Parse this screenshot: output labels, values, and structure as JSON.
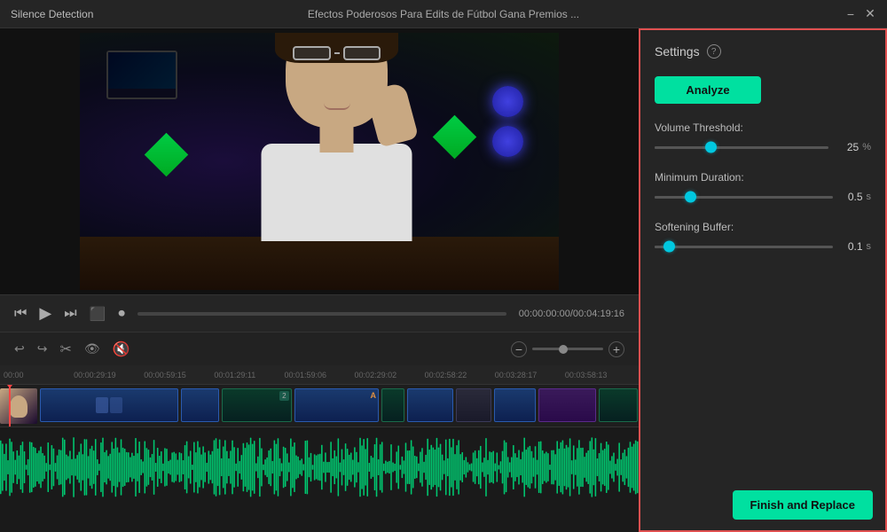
{
  "titleBar": {
    "appName": "Silence Detection",
    "videoTitle": "Efectos Poderosos Para Edits de Fútbol  Gana Premios ...",
    "minimizeLabel": "−",
    "closeLabel": "✕"
  },
  "player": {
    "currentTime": "00:00:00:00",
    "totalTime": "00:04:19:16",
    "timeDisplay": "00:00:00:00/00:04:19:16"
  },
  "settings": {
    "title": "Settings",
    "helpTooltip": "?",
    "analyzeLabel": "Analyze",
    "volumeThreshold": {
      "label": "Volume Threshold:",
      "value": "25",
      "unit": "%",
      "fillPercent": 32
    },
    "minimumDuration": {
      "label": "Minimum Duration:",
      "value": "0.5",
      "unit": "s",
      "fillPercent": 20
    },
    "softeningBuffer": {
      "label": "Softening Buffer:",
      "value": "0.1",
      "unit": "s",
      "fillPercent": 8
    }
  },
  "timeline": {
    "timeMarkers": [
      "00:00",
      "00:00:29:19",
      "00:00:59:15",
      "00:01:29:11",
      "00:01:59:06",
      "00:02:29:02",
      "00:02:58:22",
      "00:03:28:17",
      "00:03:58:13"
    ],
    "shortMarkers": [
      "00:00",
      "0:29",
      "0:59",
      "1:29",
      "1:59",
      "2:29",
      "2:58",
      "3:28",
      "3:58"
    ]
  },
  "toolbar": {
    "finishAndReplaceLabel": "Finish and Replace"
  }
}
